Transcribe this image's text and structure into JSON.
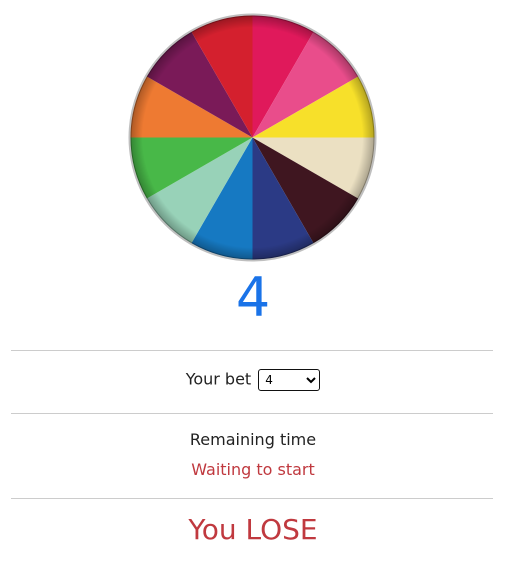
{
  "wheel": {
    "segments": [
      {
        "color": "#e0195b"
      },
      {
        "color": "#e94d8b"
      },
      {
        "color": "#f7e02a"
      },
      {
        "color": "#ebe0c2"
      },
      {
        "color": "#3f1620"
      },
      {
        "color": "#2b3a85"
      },
      {
        "color": "#1679c2"
      },
      {
        "color": "#98d2b8"
      },
      {
        "color": "#48b848"
      },
      {
        "color": "#ee7a32"
      },
      {
        "color": "#7a1a58"
      },
      {
        "color": "#d4202e"
      }
    ]
  },
  "result": {
    "number": "4",
    "color": "#1a73e8"
  },
  "bet": {
    "label": "Your bet",
    "selected": "4"
  },
  "timer": {
    "label": "Remaining time",
    "status": "Waiting to start",
    "status_color": "#c0393f"
  },
  "outcome": {
    "text": "You LOSE",
    "color": "#c0393f"
  }
}
